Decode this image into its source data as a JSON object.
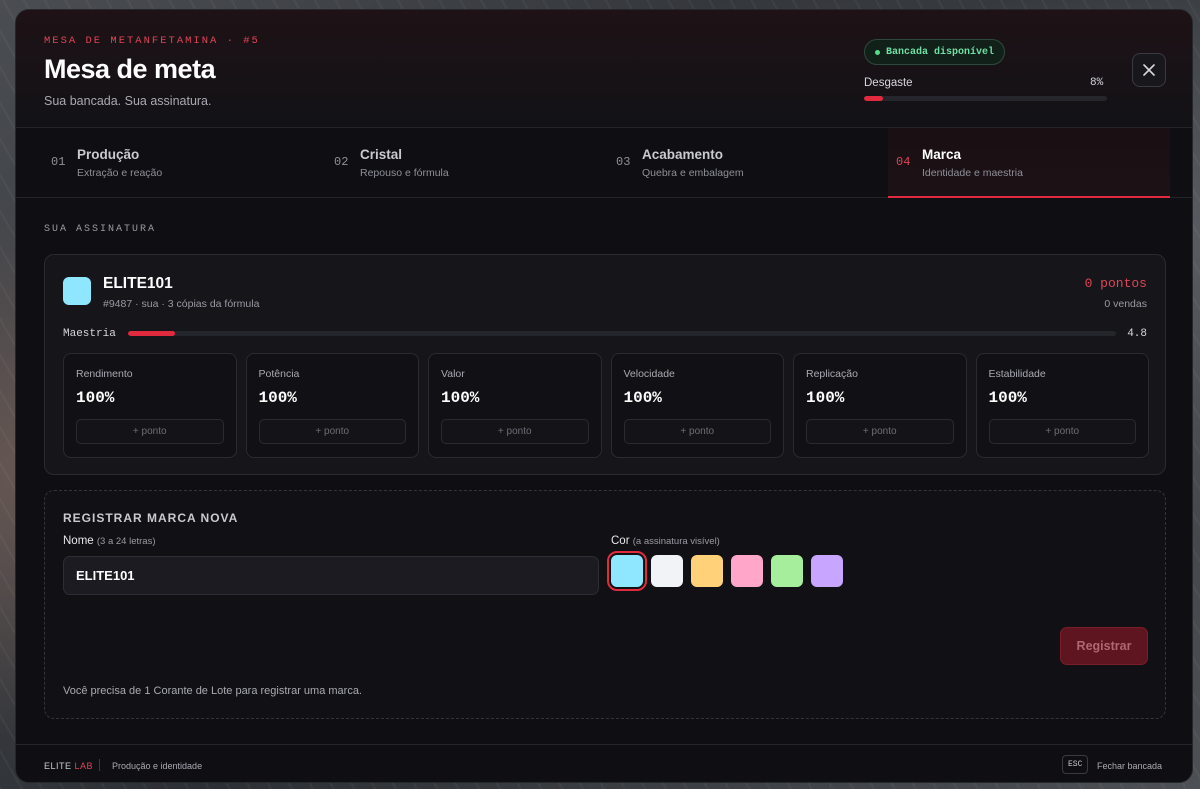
{
  "header": {
    "eyebrow": "MESA DE METANFETAMINA · #5",
    "title": "Mesa de meta",
    "subtitle": "Sua bancada. Sua assinatura.",
    "status": "Bancada disponível",
    "wear_label": "Desgaste",
    "wear_value": "8%",
    "wear_level": 0.08,
    "close_icon": "close-icon"
  },
  "tabs": [
    {
      "num": "01",
      "name": "Produção",
      "desc": "Extração e reação"
    },
    {
      "num": "02",
      "name": "Cristal",
      "desc": "Repouso e fórmula"
    },
    {
      "num": "03",
      "name": "Acabamento",
      "desc": "Quebra e embalagem"
    },
    {
      "num": "04",
      "name": "Marca",
      "desc": "Identidade e maestria"
    }
  ],
  "signature": {
    "section_label": "SUA ASSINATURA",
    "brand_name": "ELITE101",
    "brand_color": "#8ee6ff",
    "meta": "#9487 · sua · 3 cópias da fórmula",
    "points": "0 pontos",
    "sales": "0 vendas",
    "mastery_label": "Maestria",
    "mastery_value": "4.8",
    "mastery_level": 0.048,
    "stats": [
      {
        "label": "Rendimento",
        "value": "100%",
        "add": "+ ponto"
      },
      {
        "label": "Potência",
        "value": "100%",
        "add": "+ ponto"
      },
      {
        "label": "Valor",
        "value": "100%",
        "add": "+ ponto"
      },
      {
        "label": "Velocidade",
        "value": "100%",
        "add": "+ ponto"
      },
      {
        "label": "Replicação",
        "value": "100%",
        "add": "+ ponto"
      },
      {
        "label": "Estabilidade",
        "value": "100%",
        "add": "+ ponto"
      }
    ]
  },
  "register": {
    "title": "REGISTRAR MARCA NOVA",
    "name_label": "Nome",
    "name_hint": "(3 a 24 letras)",
    "name_value": "ELITE101",
    "color_label": "Cor",
    "color_hint": "(a assinatura visível)",
    "colors": [
      "#8ee6ff",
      "#f2f3f7",
      "#ffd27a",
      "#ffa6c9",
      "#a6ee9c",
      "#c8a6ff"
    ],
    "button": "Registrar",
    "requirement": "Você precisa de 1 Corante de Lote para registrar uma marca."
  },
  "footer": {
    "brand_main": "ELITE",
    "brand_accent": "LAB",
    "text": "Produção e identidade",
    "esc_key": "ESC",
    "close_hint": "Fechar bancada"
  },
  "colors": {
    "accent": "#e02a3e",
    "success": "#4ee08a"
  }
}
